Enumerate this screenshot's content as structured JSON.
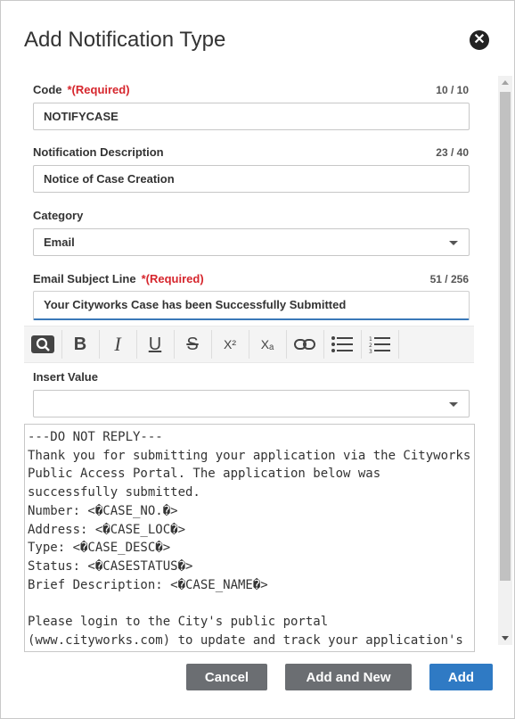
{
  "dialog": {
    "title": "Add Notification Type"
  },
  "fields": {
    "code": {
      "label": "Code",
      "required": "*(Required)",
      "counter": "10 / 10",
      "value": "NOTIFYCASE"
    },
    "description": {
      "label": "Notification Description",
      "counter": "23 / 40",
      "value": "Notice of Case Creation"
    },
    "category": {
      "label": "Category",
      "value": "Email"
    },
    "subject": {
      "label": "Email Subject Line",
      "required": "*(Required)",
      "counter": "51 / 256",
      "value": "Your Cityworks Case has been Successfully Submitted"
    },
    "insert_value": {
      "label": "Insert Value",
      "value": ""
    }
  },
  "toolbar": {
    "buttons": [
      {
        "name": "find-icon",
        "glyph": ""
      },
      {
        "name": "bold-icon",
        "glyph": "B"
      },
      {
        "name": "italic-icon",
        "glyph": "I"
      },
      {
        "name": "underline-icon",
        "glyph": "U"
      },
      {
        "name": "strikethrough-icon",
        "glyph": "S"
      },
      {
        "name": "superscript-icon",
        "glyph": "X²"
      },
      {
        "name": "subscript-icon",
        "glyph": "Xₐ"
      },
      {
        "name": "link-icon",
        "glyph": ""
      },
      {
        "name": "bulleted-list-icon",
        "glyph": ""
      },
      {
        "name": "numbered-list-icon",
        "glyph": ""
      }
    ]
  },
  "editor": {
    "body": "---DO NOT REPLY---\nThank you for submitting your application via the Cityworks Public Access Portal. The application below was successfully submitted.\nNumber: <�CASE_NO.�>\nAddress: <�CASE_LOC�>\nType: <�CASE_DESC�>\nStatus: <�CASESTATUS�>\nBrief Description: <�CASE_NAME�>\n\nPlease login to the City's public portal (www.cityworks.com) to update and track your application's status."
  },
  "footer": {
    "cancel_label": "Cancel",
    "add_new_label": "Add and New",
    "add_label": "Add"
  },
  "colors": {
    "required": "#d6262d",
    "secondary_button": "#6b6e72",
    "primary_button": "#2f7ac4",
    "focus_underline": "#3a78b8"
  }
}
